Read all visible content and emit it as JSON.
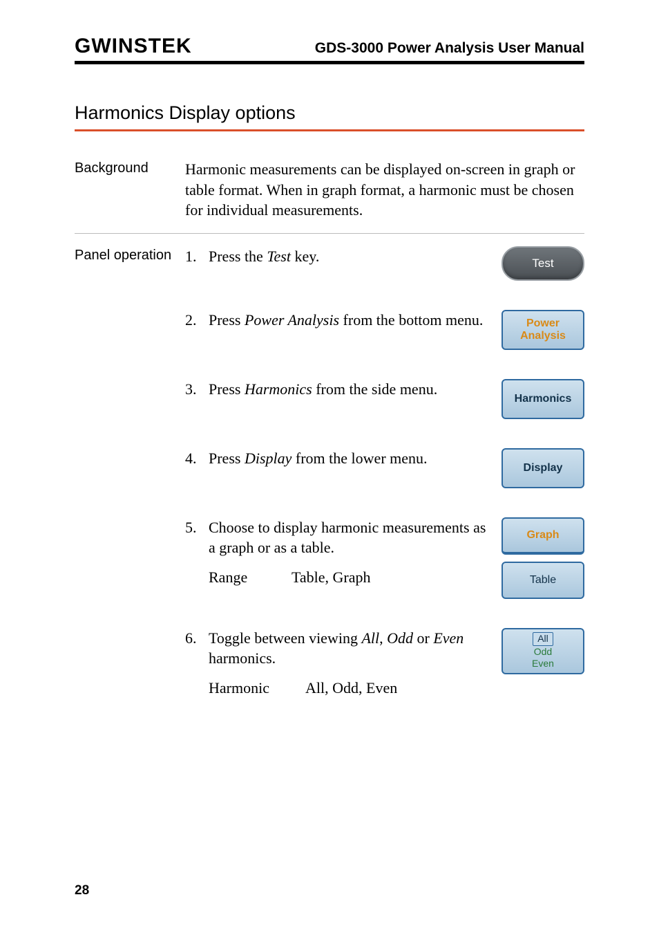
{
  "header": {
    "logo_text": "GWINSTEK",
    "title": "GDS-3000 Power Analysis User Manual"
  },
  "section": {
    "title": "Harmonics Display options"
  },
  "background": {
    "label": "Background",
    "text": "Harmonic measurements can be displayed on-screen in graph or table format. When in graph format, a harmonic must be chosen for individual measurements."
  },
  "panel": {
    "label": "Panel operation",
    "steps": [
      {
        "num": "1.",
        "text_before": "Press the ",
        "em": "Test",
        "text_after": " key.",
        "buttons": [
          {
            "type": "test",
            "label": "Test"
          }
        ]
      },
      {
        "num": "2.",
        "text_before": "Press ",
        "em": "Power Analysis",
        "text_after": " from the bottom menu.",
        "buttons": [
          {
            "type": "softkey",
            "line1": "Power",
            "line2": "Analysis",
            "style": "orange"
          }
        ]
      },
      {
        "num": "3.",
        "text_before": "Press ",
        "em": "Harmonics",
        "text_after": " from the side menu.",
        "buttons": [
          {
            "type": "softkey",
            "line1": "Harmonics",
            "style": "dark"
          }
        ]
      },
      {
        "num": "4.",
        "text_before": "Press ",
        "em": "Display",
        "text_after": " from the lower menu.",
        "buttons": [
          {
            "type": "softkey",
            "line1": "Display",
            "style": "dark"
          }
        ]
      },
      {
        "num": "5.",
        "text_before": "Choose to display harmonic measurements as a graph or as a table.",
        "em": "",
        "text_after": "",
        "range": {
          "label": "Range",
          "value": "Table, Graph"
        },
        "buttons": [
          {
            "type": "softkey",
            "line1": "Graph",
            "style": "orange-top"
          },
          {
            "type": "softkey",
            "line1": "Table",
            "style": "plain"
          }
        ]
      },
      {
        "num": "6.",
        "text_before": "Toggle between viewing ",
        "em": "All",
        "mid1": ", ",
        "em2": "Odd",
        "mid2": " or ",
        "em3": "Even",
        "text_after": " harmonics.",
        "range": {
          "label": "Harmonic",
          "value": "All, Odd, Even"
        },
        "buttons": [
          {
            "type": "softkey-toggle",
            "opt1": "All",
            "opt2": "Odd",
            "opt3": "Even"
          }
        ]
      }
    ]
  },
  "page_number": "28"
}
